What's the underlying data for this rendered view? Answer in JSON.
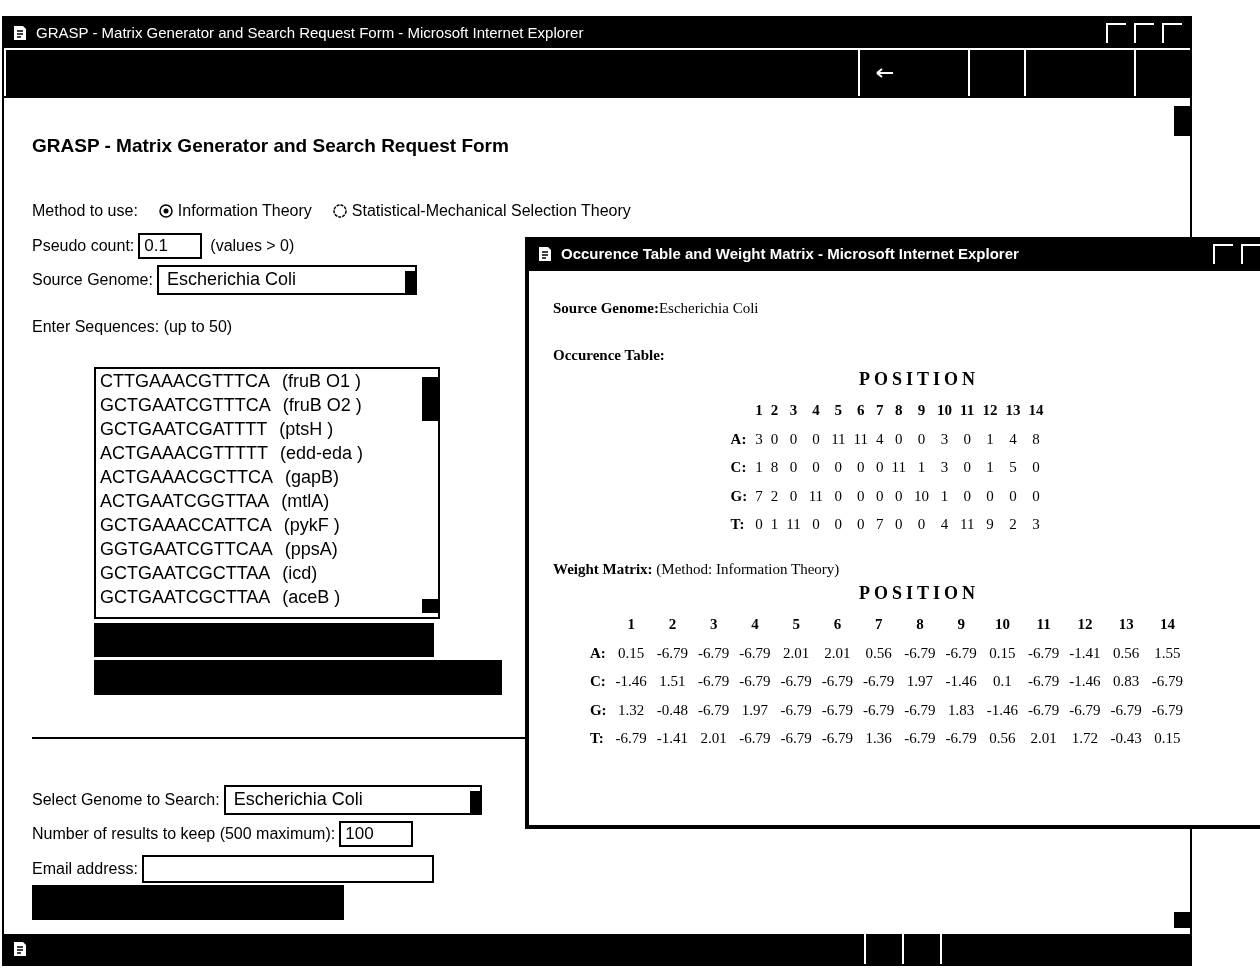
{
  "main_window": {
    "title": "GRASP - Matrix Generator and Search Request Form - Microsoft Internet Explorer",
    "heading": "GRASP - Matrix Generator and Search Request Form",
    "method": {
      "label": "Method to use:",
      "options": [
        {
          "label": "Information Theory",
          "selected": true
        },
        {
          "label": "Statistical-Mechanical Selection Theory",
          "selected": false
        }
      ]
    },
    "pseudo_count": {
      "label": "Pseudo count:",
      "value": "0.1",
      "hint": "(values > 0)"
    },
    "source_genome": {
      "label": "Source Genome:",
      "value": "Escherichia Coli"
    },
    "sequences": {
      "label": "Enter Sequences: (up to 50)",
      "lines": [
        {
          "sequence": "CTTGAAACGTTTCA",
          "name": "(fruB O1 )"
        },
        {
          "sequence": "GCTGAATCGTTTCA",
          "name": "(fruB O2 )"
        },
        {
          "sequence": "GCTGAATCGATTTT",
          "name": "(ptsH )"
        },
        {
          "sequence": "ACTGAAACGTTTTT",
          "name": "(edd-eda )"
        },
        {
          "sequence": "ACTGAAACGCTTCA",
          "name": "(gapB)"
        },
        {
          "sequence": "ACTGAATCGGTTAA",
          "name": "(mtlA)"
        },
        {
          "sequence": "GCTGAAACCATTCA",
          "name": "(pykF )"
        },
        {
          "sequence": "GGTGAATCGTTCAA",
          "name": "(ppsA)"
        },
        {
          "sequence": "GCTGAATCGCTTAA",
          "name": "(icd)"
        },
        {
          "sequence": "GCTGAATCGCTTAA",
          "name": "(aceB )"
        }
      ]
    },
    "search_genome": {
      "label": "Select Genome to Search:",
      "value": "Escherichia Coli"
    },
    "results": {
      "label": "Number of results to keep (500 maximum):",
      "value": "100"
    },
    "email": {
      "label": "Email address:"
    }
  },
  "popup_window": {
    "title": "Occurence Table and Weight Matrix - Microsoft Internet Explorer",
    "source_genome": {
      "label": "Source Genome:",
      "value": "Escherichia Coli"
    },
    "occurrence_table": {
      "title": "Occurence Table:",
      "header": "POSITION",
      "columns": [
        "1",
        "2",
        "3",
        "4",
        "5",
        "6",
        "7",
        "8",
        "9",
        "10",
        "11",
        "12",
        "13",
        "14"
      ],
      "rows": [
        {
          "label": "A:",
          "values": [
            "3",
            "0",
            "0",
            "0",
            "11",
            "11",
            "4",
            "0",
            "0",
            "3",
            "0",
            "1",
            "4",
            "8"
          ]
        },
        {
          "label": "C:",
          "values": [
            "1",
            "8",
            "0",
            "0",
            "0",
            "0",
            "0",
            "11",
            "1",
            "3",
            "0",
            "1",
            "5",
            "0"
          ]
        },
        {
          "label": "G:",
          "values": [
            "7",
            "2",
            "0",
            "11",
            "0",
            "0",
            "0",
            "0",
            "10",
            "1",
            "0",
            "0",
            "0",
            "0"
          ]
        },
        {
          "label": "T:",
          "values": [
            "0",
            "1",
            "11",
            "0",
            "0",
            "0",
            "7",
            "0",
            "0",
            "4",
            "11",
            "9",
            "2",
            "3"
          ]
        }
      ]
    },
    "weight_matrix": {
      "title": "Weight Matrix:",
      "note": "(Method: Information Theory)",
      "header": "POSITION",
      "columns": [
        "1",
        "2",
        "3",
        "4",
        "5",
        "6",
        "7",
        "8",
        "9",
        "10",
        "11",
        "12",
        "13",
        "14"
      ],
      "rows": [
        {
          "label": "A:",
          "values": [
            "0.15",
            "-6.79",
            "-6.79",
            "-6.79",
            "2.01",
            "2.01",
            "0.56",
            "-6.79",
            "-6.79",
            "0.15",
            "-6.79",
            "-1.41",
            "0.56",
            "1.55"
          ]
        },
        {
          "label": "C:",
          "values": [
            "-1.46",
            "1.51",
            "-6.79",
            "-6.79",
            "-6.79",
            "-6.79",
            "-6.79",
            "1.97",
            "-1.46",
            "0.1",
            "-6.79",
            "-1.46",
            "0.83",
            "-6.79"
          ]
        },
        {
          "label": "G:",
          "values": [
            "1.32",
            "-0.48",
            "-6.79",
            "1.97",
            "-6.79",
            "-6.79",
            "-6.79",
            "-6.79",
            "1.83",
            "-1.46",
            "-6.79",
            "-6.79",
            "-6.79",
            "-6.79"
          ]
        },
        {
          "label": "T:",
          "values": [
            "-6.79",
            "-1.41",
            "2.01",
            "-6.79",
            "-6.79",
            "-6.79",
            "1.36",
            "-6.79",
            "-6.79",
            "0.56",
            "2.01",
            "1.72",
            "-0.43",
            "0.15"
          ]
        }
      ]
    }
  }
}
